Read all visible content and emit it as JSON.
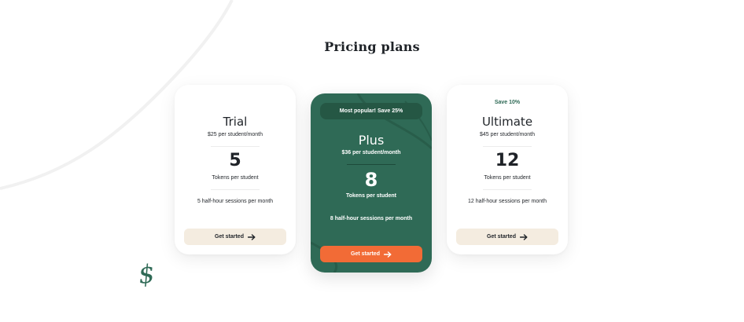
{
  "title": "Pricing plans",
  "plans": {
    "trial": {
      "name": "Trial",
      "price": "$25 per student/month",
      "tokens": "5",
      "tokens_label": "Tokens per student",
      "sessions": "5 half-hour sessions per month",
      "cta": "Get started"
    },
    "plus": {
      "badge": "Most popular! Save 25%",
      "name": "Plus",
      "price": "$36 per student/month",
      "tokens": "8",
      "tokens_label": "Tokens per student",
      "sessions": "8 half-hour sessions per month",
      "cta": "Get started"
    },
    "ultimate": {
      "badge": "Save 10%",
      "name": "Ultimate",
      "price": "$45 per student/month",
      "tokens": "12",
      "tokens_label": "Tokens per student",
      "sessions": "12 half-hour sessions per month",
      "cta": "Get started"
    }
  },
  "decoration": {
    "dollar_glyph": "$",
    "icons": [
      "arrow-right-icon",
      "dollar-sign-icon"
    ]
  },
  "colors": {
    "brand_green": "#2f6a56",
    "accent_orange": "#f26b36",
    "button_cream": "#f4ece0"
  }
}
